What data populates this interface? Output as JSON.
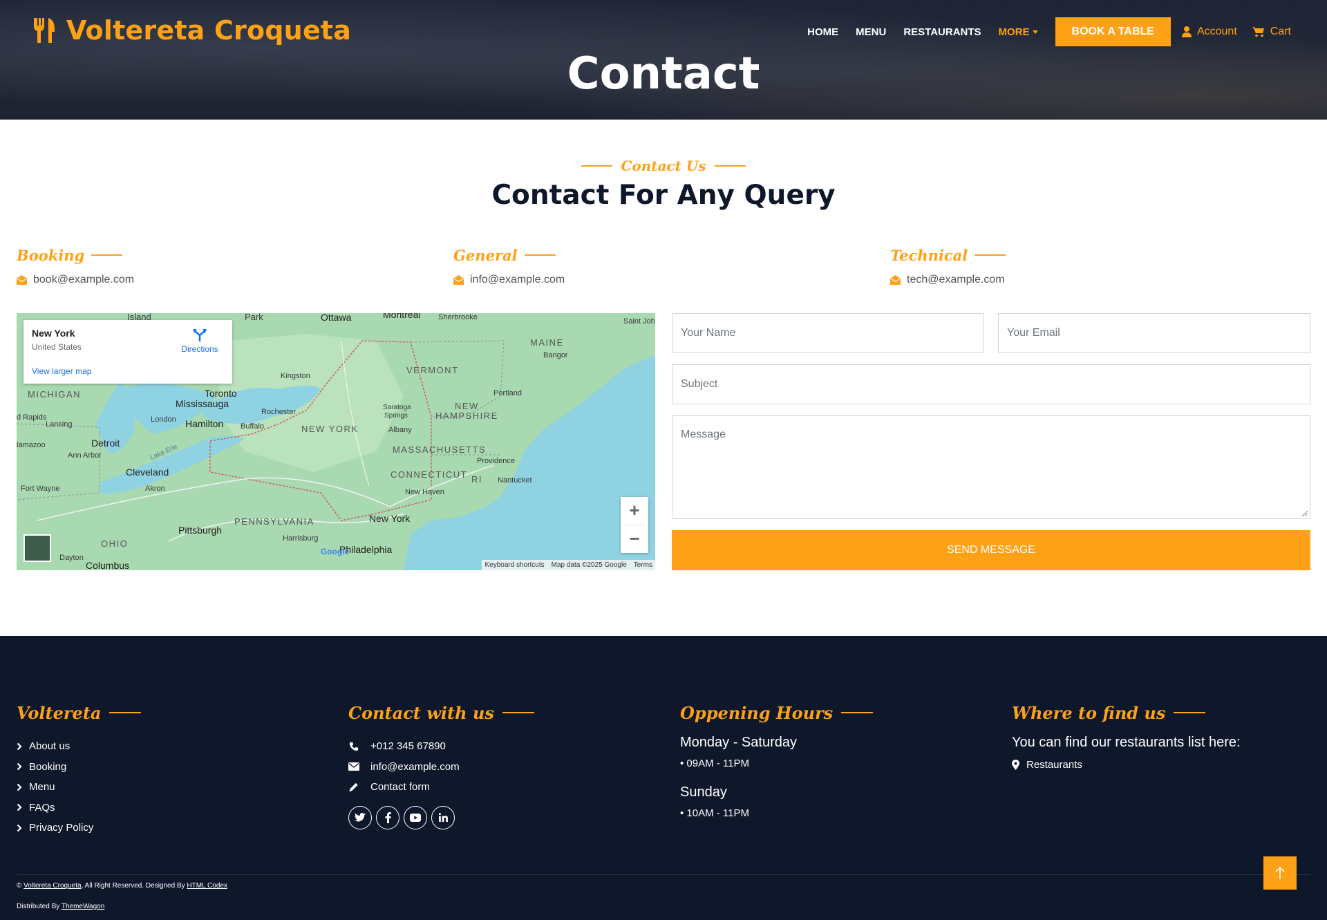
{
  "brand": {
    "name": "Voltereta Croqueta"
  },
  "nav": {
    "items": [
      "HOME",
      "MENU",
      "RESTAURANTS"
    ],
    "more_label": "MORE",
    "book_label": "BOOK A TABLE",
    "account_label": "Account",
    "cart_label": "Cart"
  },
  "hero": {
    "title": "Contact"
  },
  "contact": {
    "eyebrow": "Contact Us",
    "title": "Contact For Any Query",
    "columns": [
      {
        "heading": "Booking",
        "email": "book@example.com"
      },
      {
        "heading": "General",
        "email": "info@example.com"
      },
      {
        "heading": "Technical",
        "email": "tech@example.com"
      }
    ]
  },
  "map": {
    "place_name": "New York",
    "place_country": "United States",
    "directions_label": "Directions",
    "larger_map_label": "View larger map",
    "zoom_in": "+",
    "zoom_out": "−",
    "attribution": [
      "Keyboard shortcuts",
      "Map data ©2025 Google",
      "Terms"
    ],
    "labels": [
      "Ottawa",
      "Montreal",
      "Sherbrooke",
      "Saint Joh",
      "Island",
      "Park",
      "MAINE",
      "Bangor",
      "VERMONT",
      "Kingston",
      "MICHIGAN",
      "Toronto",
      "Mississauga",
      "Portland",
      "NEW",
      "HAMPSHIRE",
      "Rochester",
      "Saratoga",
      "Springs",
      "London",
      "Hamilton",
      "Buffalo",
      "NEW YORK",
      "Albany",
      "d Rapids",
      "Lansing",
      "Detroit",
      "MASSACHUSETTS",
      "lamazoo",
      "Ann Arbor",
      "Lake Erie",
      "Providence",
      "Cleveland",
      "CONNECTICUT",
      "RI",
      "Nantucket",
      "Fort Wayne",
      "Akron",
      "New Haven",
      "PENNSYLVANIA",
      "New York",
      "Pittsburgh",
      "OHIO",
      "Harrisburg",
      "Philadelphia",
      "Dayton",
      "Columbus",
      "Google"
    ]
  },
  "form": {
    "name_placeholder": "Your Name",
    "email_placeholder": "Your Email",
    "subject_placeholder": "Subject",
    "message_placeholder": "Message",
    "send_label": "SEND MESSAGE"
  },
  "footer": {
    "col1": {
      "heading": "Voltereta",
      "links": [
        "About us",
        "Booking",
        "Menu",
        "FAQs",
        "Privacy Policy"
      ]
    },
    "col2": {
      "heading": "Contact with us",
      "phone": "+012 345 67890",
      "email": "info@example.com",
      "form_label": "Contact form",
      "socials": [
        "twitter-icon",
        "facebook-icon",
        "youtube-icon",
        "linkedin-icon"
      ]
    },
    "col3": {
      "heading": "Oppening Hours",
      "day1": "Monday - Saturday",
      "time1": "• 09AM - 11PM",
      "day2": "Sunday",
      "time2": "• 10AM - 11PM"
    },
    "col4": {
      "heading": "Where to find us",
      "text": "You can find our restaurants list here:",
      "link": "Restaurants"
    },
    "copyright": {
      "prefix": "© ",
      "site": "Voltereta Croqueta",
      "mid": ", All Right Reserved. Designed By ",
      "designer": "HTML Codex"
    },
    "distributed": {
      "prefix": "Distributed By ",
      "name": "ThemeWagon"
    }
  },
  "colors": {
    "accent": "#FEA116",
    "dark": "#0F172B"
  }
}
